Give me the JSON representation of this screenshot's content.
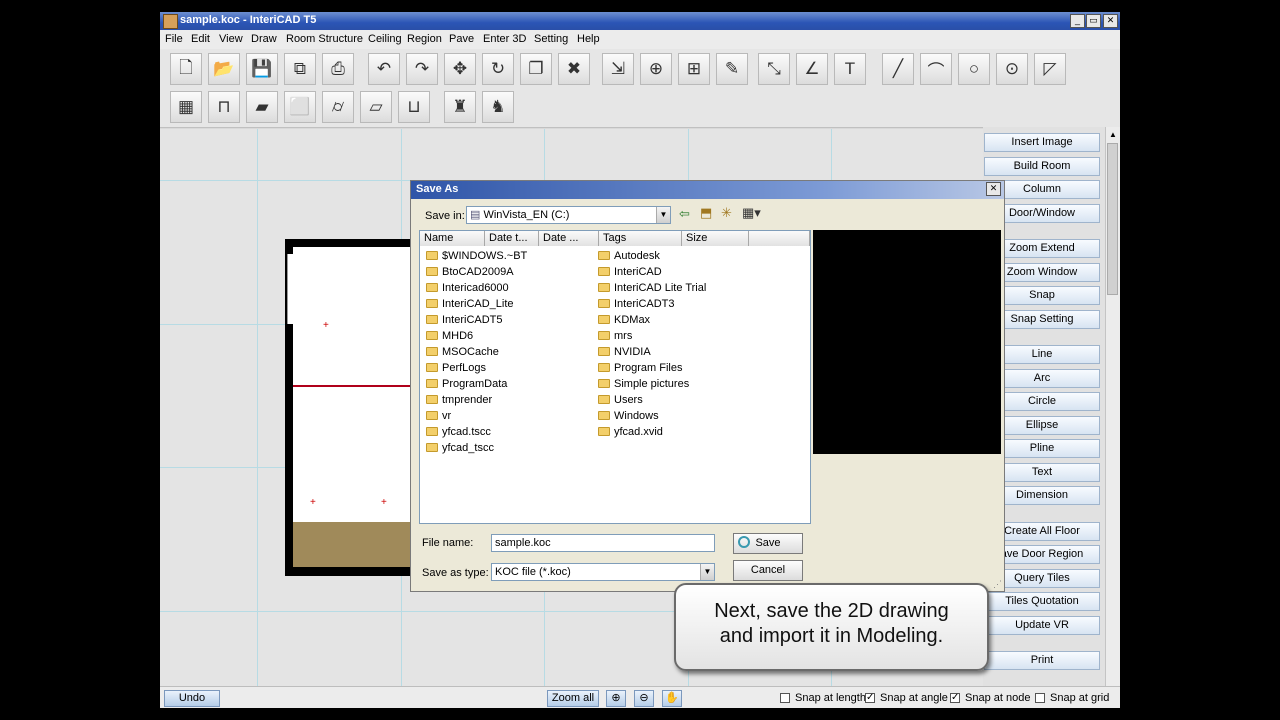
{
  "window": {
    "title": "sample.koc - InteriCAD T5",
    "min": "_",
    "max": "▭",
    "close": "✕"
  },
  "menu": [
    "File",
    "Edit",
    "View",
    "Draw",
    "Room Structure",
    "Ceiling",
    "Region",
    "Pave",
    "Enter 3D",
    "Setting",
    "Help"
  ],
  "toolbar1": [
    {
      "name": "new-icon",
      "glyph": "🗋"
    },
    {
      "name": "open-icon",
      "glyph": "📂"
    },
    {
      "name": "save-icon",
      "glyph": "💾"
    },
    {
      "name": "copy-window-icon",
      "glyph": "⧉"
    },
    {
      "name": "print-icon",
      "glyph": "⎙"
    },
    {
      "name": "undo-icon",
      "glyph": "↶"
    },
    {
      "name": "redo-icon",
      "glyph": "↷"
    },
    {
      "name": "move-icon",
      "glyph": "✥"
    },
    {
      "name": "rotate-icon",
      "glyph": "↻"
    },
    {
      "name": "copy-icon",
      "glyph": "❐"
    },
    {
      "name": "delete-icon",
      "glyph": "✖"
    },
    {
      "name": "import-icon",
      "glyph": "⇲"
    },
    {
      "name": "add-icon",
      "glyph": "⊕"
    },
    {
      "name": "doc-add-icon",
      "glyph": "⊞"
    },
    {
      "name": "doc-edit-icon",
      "glyph": "✎"
    },
    {
      "name": "measure-icon",
      "glyph": "⤡"
    },
    {
      "name": "angle-icon",
      "glyph": "∠"
    },
    {
      "name": "text-icon",
      "glyph": "T"
    },
    {
      "name": "line-icon",
      "glyph": "╱"
    },
    {
      "name": "arc-icon",
      "glyph": "⌒"
    },
    {
      "name": "circle-icon",
      "glyph": "○"
    },
    {
      "name": "circle-center-icon",
      "glyph": "⊙"
    },
    {
      "name": "polyline-icon",
      "glyph": "◸"
    }
  ],
  "toolbar2": [
    {
      "name": "wall-icon",
      "glyph": "▦"
    },
    {
      "name": "door-frame-icon",
      "glyph": "⊓"
    },
    {
      "name": "slab-icon",
      "glyph": "▰"
    },
    {
      "name": "box-icon",
      "glyph": "⬜"
    },
    {
      "name": "cylinder-icon",
      "glyph": "⌭"
    },
    {
      "name": "beam-icon",
      "glyph": "▱"
    },
    {
      "name": "window-frame-icon",
      "glyph": "⊔"
    },
    {
      "name": "furniture-icon",
      "glyph": "♜"
    },
    {
      "name": "chair-icon",
      "glyph": "♞"
    }
  ],
  "right_panel": [
    "Insert Image",
    "Build Room",
    "Column",
    "Door/Window",
    "Zoom Extend",
    "Zoom Window",
    "Snap",
    "Snap Setting",
    "Line",
    "Arc",
    "Circle",
    "Ellipse",
    "Pline",
    "Text",
    "Dimension",
    "Create All Floor",
    "ave Door Region",
    "Query Tiles",
    "Tiles Quotation",
    "Update VR",
    "Print"
  ],
  "status": {
    "undo": "Undo",
    "zoom_all": "Zoom all",
    "checks": [
      {
        "label": "Snap at length",
        "checked": false
      },
      {
        "label": "Snap at angle",
        "checked": true
      },
      {
        "label": "Snap at node",
        "checked": true
      },
      {
        "label": "Snap at grid",
        "checked": false
      }
    ]
  },
  "dialog": {
    "title": "Save As",
    "save_in_label": "Save in:",
    "save_in_value": "WinVista_EN (C:)",
    "columns": [
      "Name",
      "Date t...",
      "Date ...",
      "Tags",
      "Size"
    ],
    "col1": [
      "$WINDOWS.~BT",
      "BtoCAD2009A",
      "Intericad6000",
      "InteriCAD_Lite",
      "InteriCADT5",
      "MHD6",
      "MSOCache",
      "PerfLogs",
      "ProgramData",
      "tmprender",
      "vr",
      "yfcad.tscc",
      "yfcad_tscc"
    ],
    "col2": [
      "Autodesk",
      "InteriCAD",
      "InteriCAD Lite Trial",
      "InteriCADT3",
      "KDMax",
      "mrs",
      "NVIDIA",
      "Program Files",
      "Simple pictures",
      "Users",
      "Windows",
      "yfcad.xvid"
    ],
    "file_name_label": "File name:",
    "file_name_value": "sample.koc",
    "save_type_label": "Save as type:",
    "save_type_value": "KOC file (*.koc)",
    "save_button": "Save",
    "cancel_button": "Cancel"
  },
  "callout": {
    "line1": "Next, save the 2D drawing",
    "line2": "and import it in Modeling."
  }
}
